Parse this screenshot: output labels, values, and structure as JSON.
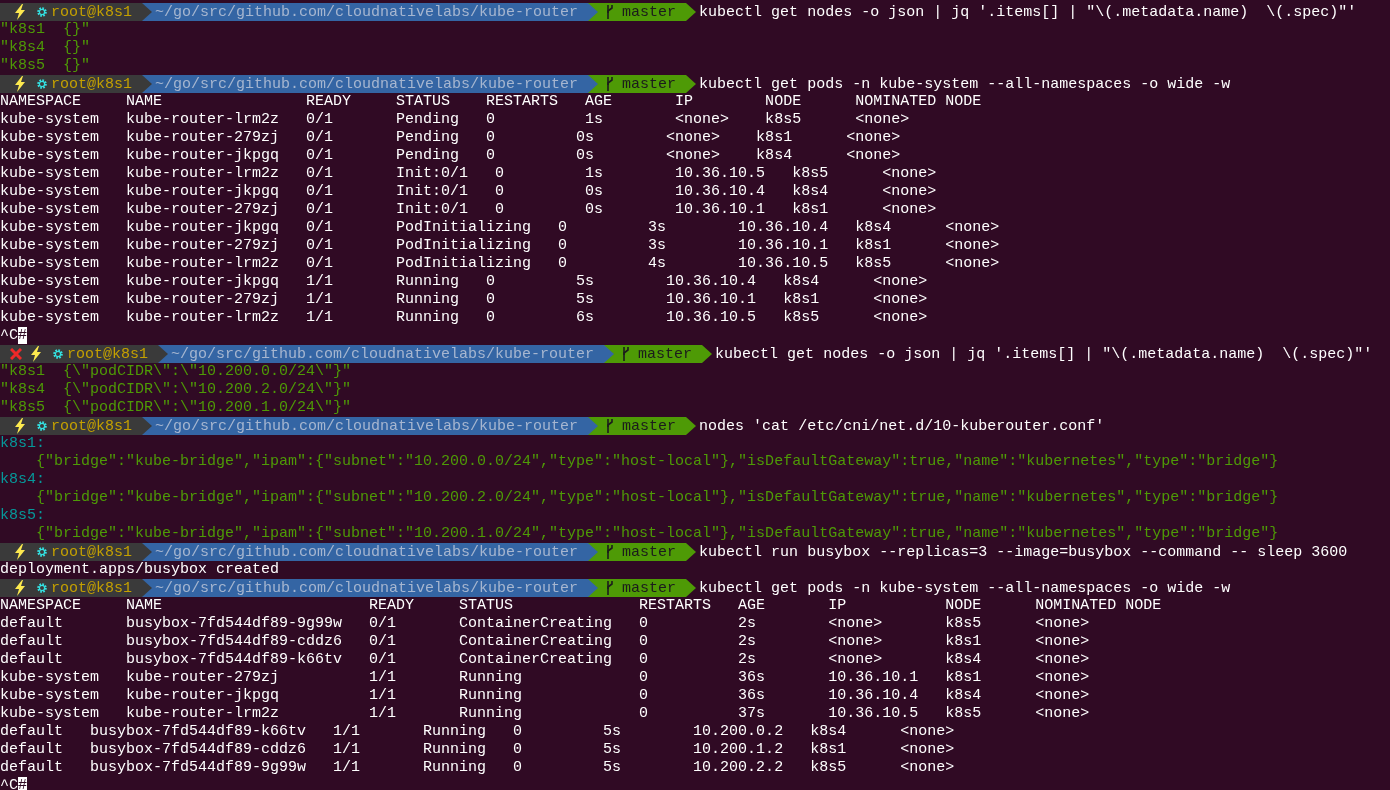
{
  "lines": [
    {
      "kind": "prompt",
      "error": false,
      "user": "root@k8s1",
      "path": "~/go/src/github.com/cloudnativelabs/kube-router",
      "branch": "master",
      "command": "kubectl get nodes -o json | jq '.items[] | \"\\(.metadata.name)  \\(.spec)\"'"
    },
    {
      "kind": "output",
      "text": "\"k8s1  {}\"",
      "color": "#4e9a06"
    },
    {
      "kind": "output",
      "text": "\"k8s4  {}\"",
      "color": "#4e9a06"
    },
    {
      "kind": "output",
      "text": "\"k8s5  {}\"",
      "color": "#4e9a06"
    },
    {
      "kind": "prompt",
      "error": false,
      "user": "root@k8s1",
      "path": "~/go/src/github.com/cloudnativelabs/kube-router",
      "branch": "master",
      "command": "kubectl get pods -n kube-system --all-namespaces -o wide -w"
    },
    {
      "kind": "output",
      "text": "NAMESPACE     NAME                READY     STATUS    RESTARTS   AGE       IP        NODE      NOMINATED NODE",
      "color": "#ffffff"
    },
    {
      "kind": "output",
      "text": "kube-system   kube-router-lrm2z   0/1       Pending   0          1s        <none>    k8s5      <none>",
      "color": "#ffffff"
    },
    {
      "kind": "output",
      "text": "kube-system   kube-router-279zj   0/1       Pending   0         0s        <none>    k8s1      <none>",
      "color": "#ffffff"
    },
    {
      "kind": "output",
      "text": "kube-system   kube-router-jkpgq   0/1       Pending   0         0s        <none>    k8s4      <none>",
      "color": "#ffffff"
    },
    {
      "kind": "output",
      "text": "kube-system   kube-router-lrm2z   0/1       Init:0/1   0         1s        10.36.10.5   k8s5      <none>",
      "color": "#ffffff"
    },
    {
      "kind": "output",
      "text": "kube-system   kube-router-jkpgq   0/1       Init:0/1   0         0s        10.36.10.4   k8s4      <none>",
      "color": "#ffffff"
    },
    {
      "kind": "output",
      "text": "kube-system   kube-router-279zj   0/1       Init:0/1   0         0s        10.36.10.1   k8s1      <none>",
      "color": "#ffffff"
    },
    {
      "kind": "output",
      "text": "kube-system   kube-router-jkpgq   0/1       PodInitializing   0         3s        10.36.10.4   k8s4      <none>",
      "color": "#ffffff"
    },
    {
      "kind": "output",
      "text": "kube-system   kube-router-279zj   0/1       PodInitializing   0         3s        10.36.10.1   k8s1      <none>",
      "color": "#ffffff"
    },
    {
      "kind": "output",
      "text": "kube-system   kube-router-lrm2z   0/1       PodInitializing   0         4s        10.36.10.5   k8s5      <none>",
      "color": "#ffffff"
    },
    {
      "kind": "output",
      "text": "kube-system   kube-router-jkpgq   1/1       Running   0         5s        10.36.10.4   k8s4      <none>",
      "color": "#ffffff"
    },
    {
      "kind": "output",
      "text": "kube-system   kube-router-279zj   1/1       Running   0         5s        10.36.10.1   k8s1      <none>",
      "color": "#ffffff"
    },
    {
      "kind": "output",
      "text": "kube-system   kube-router-lrm2z   1/1       Running   0         6s        10.36.10.5   k8s5      <none>",
      "color": "#ffffff"
    },
    {
      "kind": "cursor",
      "text": "^C",
      "cursor": "#"
    },
    {
      "kind": "prompt",
      "error": true,
      "user": "root@k8s1",
      "path": "~/go/src/github.com/cloudnativelabs/kube-router",
      "branch": "master",
      "command": "kubectl get nodes -o json | jq '.items[] | \"\\(.metadata.name)  \\(.spec)\"'"
    },
    {
      "kind": "output",
      "text": "\"k8s1  {\\\"podCIDR\\\":\\\"10.200.0.0/24\\\"}\"",
      "color": "#4e9a06"
    },
    {
      "kind": "output",
      "text": "\"k8s4  {\\\"podCIDR\\\":\\\"10.200.2.0/24\\\"}\"",
      "color": "#4e9a06"
    },
    {
      "kind": "output",
      "text": "\"k8s5  {\\\"podCIDR\\\":\\\"10.200.1.0/24\\\"}\"",
      "color": "#4e9a06"
    },
    {
      "kind": "prompt",
      "error": false,
      "user": "root@k8s1",
      "path": "~/go/src/github.com/cloudnativelabs/kube-router",
      "branch": "master",
      "command": "nodes 'cat /etc/cni/net.d/10-kuberouter.conf'"
    },
    {
      "kind": "output",
      "text": "k8s1:",
      "color": "#06989a"
    },
    {
      "kind": "output",
      "text": "    {\"bridge\":\"kube-bridge\",\"ipam\":{\"subnet\":\"10.200.0.0/24\",\"type\":\"host-local\"},\"isDefaultGateway\":true,\"name\":\"kubernetes\",\"type\":\"bridge\"}",
      "color": "#4e9a06"
    },
    {
      "kind": "output",
      "text": "k8s4:",
      "color": "#06989a"
    },
    {
      "kind": "output",
      "text": "    {\"bridge\":\"kube-bridge\",\"ipam\":{\"subnet\":\"10.200.2.0/24\",\"type\":\"host-local\"},\"isDefaultGateway\":true,\"name\":\"kubernetes\",\"type\":\"bridge\"}",
      "color": "#4e9a06"
    },
    {
      "kind": "output",
      "text": "k8s5:",
      "color": "#06989a"
    },
    {
      "kind": "output",
      "text": "    {\"bridge\":\"kube-bridge\",\"ipam\":{\"subnet\":\"10.200.1.0/24\",\"type\":\"host-local\"},\"isDefaultGateway\":true,\"name\":\"kubernetes\",\"type\":\"bridge\"}",
      "color": "#4e9a06"
    },
    {
      "kind": "prompt",
      "error": false,
      "user": "root@k8s1",
      "path": "~/go/src/github.com/cloudnativelabs/kube-router",
      "branch": "master",
      "command": "kubectl run busybox --replicas=3 --image=busybox --command -- sleep 3600"
    },
    {
      "kind": "output",
      "text": "deployment.apps/busybox created"
    },
    {
      "kind": "prompt",
      "error": false,
      "user": "root@k8s1",
      "path": "~/go/src/github.com/cloudnativelabs/kube-router",
      "branch": "master",
      "command": "kubectl get pods -n kube-system --all-namespaces -o wide -w"
    },
    {
      "kind": "output",
      "text": "NAMESPACE     NAME                       READY     STATUS              RESTARTS   AGE       IP           NODE      NOMINATED NODE",
      "color": "#ffffff"
    },
    {
      "kind": "output",
      "text": "default       busybox-7fd544df89-9g99w   0/1       ContainerCreating   0          2s        <none>       k8s5      <none>",
      "color": "#ffffff"
    },
    {
      "kind": "output",
      "text": "default       busybox-7fd544df89-cddz6   0/1       ContainerCreating   0          2s        <none>       k8s1      <none>",
      "color": "#ffffff"
    },
    {
      "kind": "output",
      "text": "default       busybox-7fd544df89-k66tv   0/1       ContainerCreating   0          2s        <none>       k8s4      <none>",
      "color": "#ffffff"
    },
    {
      "kind": "output",
      "text": "kube-system   kube-router-279zj          1/1       Running             0          36s       10.36.10.1   k8s1      <none>",
      "color": "#ffffff"
    },
    {
      "kind": "output",
      "text": "kube-system   kube-router-jkpgq          1/1       Running             0          36s       10.36.10.4   k8s4      <none>",
      "color": "#ffffff"
    },
    {
      "kind": "output",
      "text": "kube-system   kube-router-lrm2z          1/1       Running             0          37s       10.36.10.5   k8s5      <none>",
      "color": "#ffffff"
    },
    {
      "kind": "output",
      "text": "default   busybox-7fd544df89-k66tv   1/1       Running   0         5s        10.200.0.2   k8s4      <none>",
      "color": "#ffffff"
    },
    {
      "kind": "output",
      "text": "default   busybox-7fd544df89-cddz6   1/1       Running   0         5s        10.200.1.2   k8s1      <none>",
      "color": "#ffffff"
    },
    {
      "kind": "output",
      "text": "default   busybox-7fd544df89-9g99w   1/1       Running   0         5s        10.200.2.2   k8s5      <none>",
      "color": "#ffffff"
    },
    {
      "kind": "cursor",
      "text": "^C",
      "cursor": "#"
    }
  ]
}
